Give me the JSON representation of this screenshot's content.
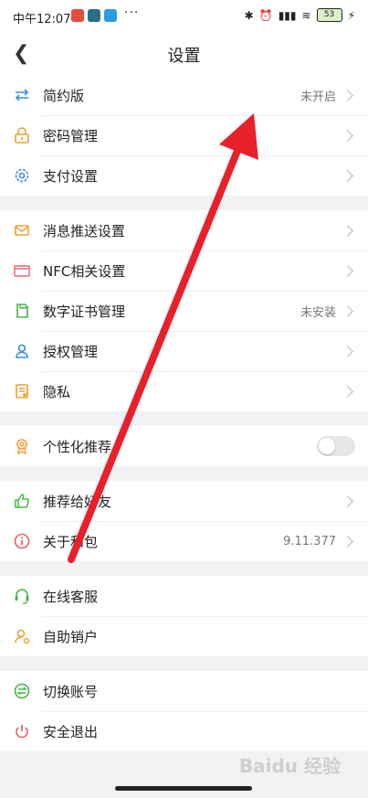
{
  "statusbar": {
    "time": "中午12:07",
    "dots": "···",
    "battery": "53"
  },
  "header": {
    "title": "设置"
  },
  "groups": [
    {
      "rows": [
        {
          "label": "简约版",
          "value": "未开启",
          "icon": "transfer-arrows-icon",
          "chevron": true
        },
        {
          "label": "密码管理",
          "value": "",
          "icon": "lock-icon",
          "chevron": true
        },
        {
          "label": "支付设置",
          "value": "",
          "icon": "gear-icon",
          "chevron": true
        }
      ]
    },
    {
      "rows": [
        {
          "label": "消息推送设置",
          "value": "",
          "icon": "message-icon",
          "chevron": true
        },
        {
          "label": "NFC相关设置",
          "value": "",
          "icon": "nfc-card-icon",
          "chevron": true
        },
        {
          "label": "数字证书管理",
          "value": "未安装",
          "icon": "certificate-icon",
          "chevron": true
        },
        {
          "label": "授权管理",
          "value": "",
          "icon": "user-authorize-icon",
          "chevron": true
        },
        {
          "label": "隐私",
          "value": "",
          "icon": "privacy-icon",
          "chevron": true
        }
      ]
    },
    {
      "rows": [
        {
          "label": "个性化推荐",
          "value": "",
          "icon": "badge-icon",
          "toggle": false
        }
      ]
    },
    {
      "rows": [
        {
          "label": "推荐给好友",
          "value": "",
          "icon": "thumbs-up-icon",
          "chevron": true
        },
        {
          "label": "关于和包",
          "value": "9.11.377",
          "icon": "info-icon",
          "chevron": true
        }
      ]
    },
    {
      "rows": [
        {
          "label": "在线客服",
          "value": "",
          "icon": "headset-icon",
          "chevron": false
        },
        {
          "label": "自助销户",
          "value": "",
          "icon": "person-icon",
          "chevron": false
        }
      ]
    },
    {
      "rows": [
        {
          "label": "切换账号",
          "value": "",
          "icon": "switch-account-icon",
          "chevron": false
        },
        {
          "label": "安全退出",
          "value": "",
          "icon": "power-icon",
          "chevron": false
        }
      ]
    }
  ],
  "watermark": "Baidu 经验",
  "colors": {
    "accent_blue": "#3a8ee6",
    "orange": "#f0a030",
    "red_arrow": "#e8202a",
    "green": "#45b845"
  }
}
